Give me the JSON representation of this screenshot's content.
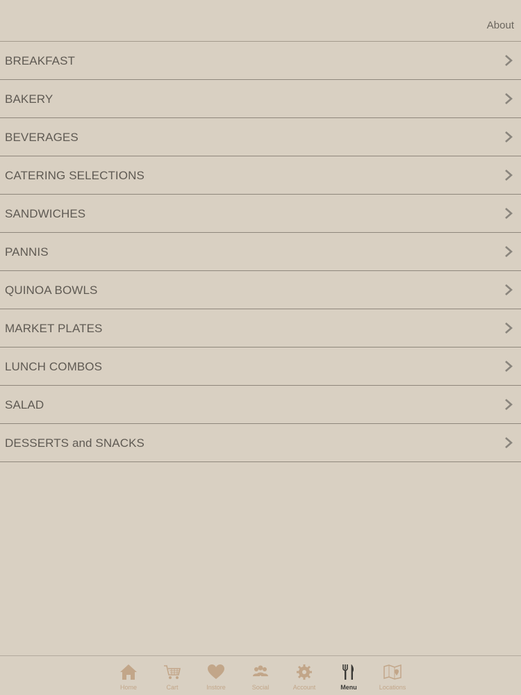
{
  "header": {
    "about_label": "About"
  },
  "menu": {
    "items": [
      {
        "label": "BREAKFAST"
      },
      {
        "label": "BAKERY"
      },
      {
        "label": "BEVERAGES"
      },
      {
        "label": "CATERING SELECTIONS"
      },
      {
        "label": "SANDWICHES"
      },
      {
        "label": "PANNIS"
      },
      {
        "label": "QUINOA BOWLS"
      },
      {
        "label": "MARKET PLATES"
      },
      {
        "label": "LUNCH COMBOS"
      },
      {
        "label": "SALAD"
      },
      {
        "label": "DESSERTS and SNACKS"
      }
    ]
  },
  "tabbar": {
    "tabs": [
      {
        "label": "Home",
        "icon": "home-icon"
      },
      {
        "label": "Cart",
        "icon": "cart-icon"
      },
      {
        "label": "Instore",
        "icon": "heart-icon"
      },
      {
        "label": "Social",
        "icon": "people-icon"
      },
      {
        "label": "Account",
        "icon": "gear-icon"
      },
      {
        "label": "Menu",
        "icon": "fork-knife-icon",
        "active": true
      },
      {
        "label": "Locations",
        "icon": "map-icon"
      }
    ],
    "colors": {
      "inactive": "#c2a689",
      "active": "#3b3a37"
    }
  },
  "colors": {
    "background": "#d9d0c2",
    "text": "#5f5a53",
    "divider": "#8f877c"
  }
}
